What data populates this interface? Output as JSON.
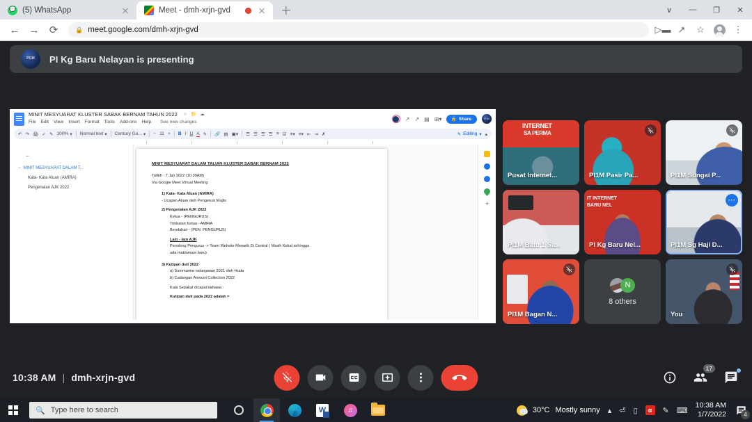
{
  "browser": {
    "tabs": [
      {
        "title": "(5) WhatsApp",
        "favicon": "whatsapp-icon",
        "active": false,
        "recording": false
      },
      {
        "title": "Meet - dmh-xrjn-gvd",
        "favicon": "google-meet-icon",
        "active": true,
        "recording": true
      }
    ],
    "new_tab_label": "+",
    "window_controls": {
      "minimize": "—",
      "maximize": "❐",
      "close": "✕",
      "more": "∨"
    },
    "nav": {
      "back": "←",
      "forward": "→",
      "reload": "⟳"
    },
    "omnibox": {
      "url": "meet.google.com/dmh-xrjn-gvd",
      "lock": "🔒"
    },
    "toolbar_icons": [
      "cast-icon",
      "share-icon",
      "bookmark-star-icon",
      "profile-avatar-icon",
      "chrome-menu-icon"
    ]
  },
  "meet": {
    "presenting_banner": {
      "text": "PI Kg Baru Nelayan is presenting",
      "avatar_initials": "PI1M"
    },
    "footer": {
      "time": "10:38 AM",
      "separator": "|",
      "meeting_code": "dmh-xrjn-gvd"
    },
    "controls": [
      {
        "name": "microphone",
        "label": "Turn off microphone",
        "state": "muted",
        "style": "danger"
      },
      {
        "name": "camera",
        "label": "Turn on camera",
        "state": "off",
        "style": "normal"
      },
      {
        "name": "captions",
        "label": "Turn on captions",
        "state": "off",
        "style": "normal"
      },
      {
        "name": "present",
        "label": "Present now",
        "state": "on",
        "style": "normal"
      },
      {
        "name": "more-options",
        "label": "More options",
        "state": "off",
        "style": "normal"
      },
      {
        "name": "leave-call",
        "label": "Leave call",
        "state": "off",
        "style": "hangup"
      }
    ],
    "right_controls": [
      {
        "name": "meeting-details",
        "label": "Meeting details",
        "badge": ""
      },
      {
        "name": "show-everyone",
        "label": "Show everyone",
        "badge": "17"
      },
      {
        "name": "chat",
        "label": "Chat with everyone",
        "badge": ""
      }
    ],
    "participants": [
      {
        "name": "Pusat Internet...",
        "muted": false,
        "highlight": false,
        "more": false,
        "bg": "bg1"
      },
      {
        "name": "PI1M Pasir Pa...",
        "muted": true,
        "highlight": false,
        "more": false,
        "bg": "bg2"
      },
      {
        "name": "PI1M Sungai P...",
        "muted": true,
        "highlight": false,
        "more": false,
        "bg": "bg3"
      },
      {
        "name": "PI1M Batu 1 Sa...",
        "muted": false,
        "highlight": false,
        "more": false,
        "bg": "bg4"
      },
      {
        "name": "PI Kg Baru Nel...",
        "muted": false,
        "highlight": false,
        "more": false,
        "bg": "bg5"
      },
      {
        "name": "PI1M Sg Haji D...",
        "muted": false,
        "highlight": true,
        "more": true,
        "bg": "bg6"
      },
      {
        "name": "PI1M Bagan N...",
        "muted": true,
        "highlight": false,
        "more": false,
        "bg": "bg7"
      },
      {
        "name": "You",
        "muted": true,
        "highlight": false,
        "more": false,
        "bg": "bg8"
      }
    ],
    "others_tile": {
      "label": "8 others",
      "avatar_letter": "N"
    }
  },
  "docs": {
    "title": "MINIT MESYUARAT KLUSTER SABAK BERNAM TAHUN 2022",
    "title_icons": [
      "star-icon",
      "move-to-folder-icon",
      "cloud-status-icon"
    ],
    "menu": [
      "File",
      "Edit",
      "View",
      "Insert",
      "Format",
      "Tools",
      "Add-ons",
      "Help"
    ],
    "saved_status": "See new changes",
    "share_label": "Share",
    "toolbar": {
      "zoom": "100%",
      "style": "Normal text",
      "font": "Century Go...",
      "font_size": "11",
      "minus": "−",
      "plus": "+",
      "bold": "B",
      "italic": "I",
      "underline": "U",
      "text_color": "A",
      "edit_mode": "Editing"
    },
    "outline": {
      "back_icon": "back-arrow-icon",
      "items": [
        {
          "label": "MINIT MESYUARAT DALAM T...",
          "level": 0
        },
        {
          "label": "Kata- Kata Aluan (AMIRA)",
          "level": 1
        },
        {
          "label": "Pengenalan AJK 2022",
          "level": 1
        }
      ]
    },
    "page": {
      "heading": "MINIT MESYUARAT DALAM TALIAN  KLUSTER SABAK BERNAM 2022",
      "line_date": "Tarikh : 7 Jan 2022 (10.30AM)",
      "line_via": "Via Google Meet Virtual Meeting",
      "item1_title": "1)  Kata- Kata Aluan (AMIRA)",
      "item1_sub": "-      Ucapan Aluan oleh Pengerusi Majlis",
      "item2_title": "2)  Pengenalan  AJK 2022",
      "item2_l1": "Ketua     -      (PENGURUS)",
      "item2_l2": "Timbalan Ketua   -  AMIRA",
      "item2_l3": "Bendahari -   (PEN. PENGURUS)",
      "lain_title": "Lain - lain AJK",
      "lain_body1": "Penolong Pengurus -> Team Website Menarik Di Central  ( Masih Kekal sehingga",
      "lain_body2": "ada maklumam baru)",
      "item3_title": "3)  Kutipan duit 2022",
      "item3_a": "a) Summarine nelanjawan 2021 oleh Huda",
      "item3_b": "b) Cadangan Amount Collection 2022",
      "item3_note": "Kata Sepakat dicapai bahawa :",
      "item3_bold": "Kutipan duit pada 2022 adalah  ="
    },
    "side_icons": [
      "keep-icon",
      "tasks-icon",
      "contacts-icon",
      "maps-icon",
      "add-ons-plus-icon"
    ]
  },
  "taskbar": {
    "start_label": "Start",
    "search_placeholder": "Type here to search",
    "search_icon": "search-icon",
    "cortana_icon": "cortana-icon",
    "apps": [
      {
        "name": "chrome-taskbar-icon",
        "active": true
      },
      {
        "name": "edge-taskbar-icon",
        "active": false
      },
      {
        "name": "word-taskbar-icon",
        "active": false
      },
      {
        "name": "itunes-taskbar-icon",
        "active": false
      },
      {
        "name": "file-explorer-taskbar-icon",
        "active": false
      }
    ],
    "weather": {
      "temperature": "30°C",
      "condition": "Mostly sunny"
    },
    "tray_icons": [
      "show-hidden-icons-chevron",
      "camera-icon",
      "battery-icon",
      "avira-icon",
      "pen-icon",
      "keyboard-icon"
    ],
    "clock": {
      "time": "10:38 AM",
      "date": "1/7/2022"
    },
    "notifications": {
      "count": "4"
    }
  }
}
